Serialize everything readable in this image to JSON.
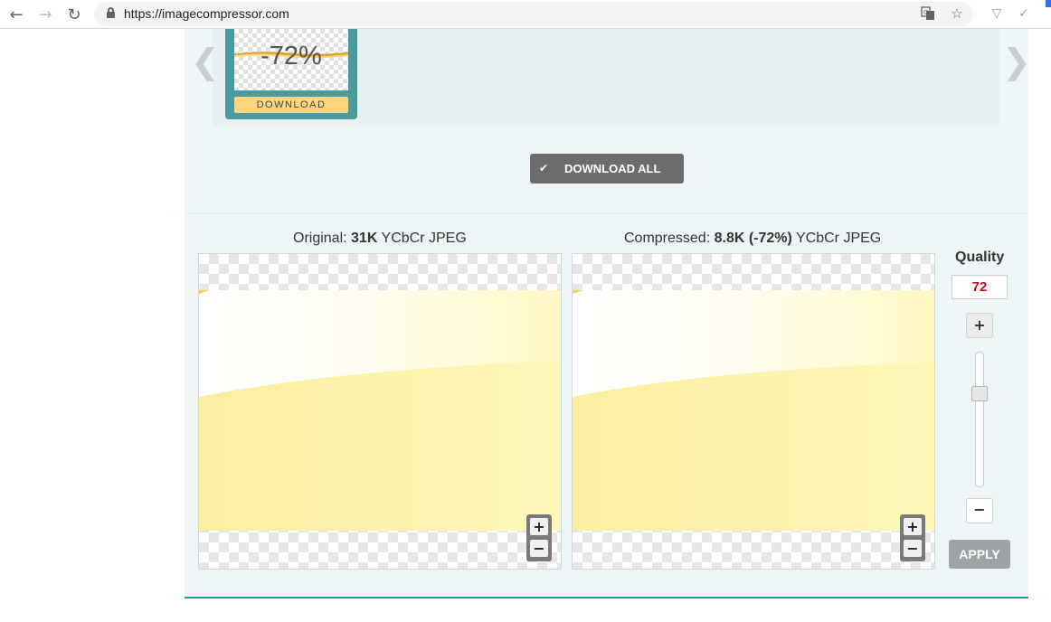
{
  "browser": {
    "url": "https://imagecompressor.com"
  },
  "carousel": {
    "thumbnail": {
      "percent": "-72%",
      "download_label": "DOWNLOAD"
    }
  },
  "download_all": {
    "label": "DOWNLOAD ALL"
  },
  "original": {
    "prefix": "Original: ",
    "size": "31K",
    "format": " YCbCr JPEG"
  },
  "compressed": {
    "prefix": "Compressed: ",
    "size": "8.8K (-72%)",
    "format": " YCbCr JPEG"
  },
  "zoom": {
    "in_label": "+",
    "out_label": "−"
  },
  "quality": {
    "label": "Quality",
    "value": "72",
    "plus_label": "+",
    "minus_label": "−",
    "apply_label": "APPLY",
    "level": 72
  },
  "colors": {
    "accent": "#2a9d8f",
    "card": "#4b9a9c",
    "quality_value": "#d0021b",
    "download_all_bg": "#6c6c6c",
    "apply_bg": "#9ea4a6"
  },
  "icons": [
    "back-arrow-icon",
    "forward-arrow-icon",
    "reload-icon",
    "lock-icon",
    "translate-icon",
    "star-icon",
    "extension-icon",
    "checkmark-icon"
  ]
}
